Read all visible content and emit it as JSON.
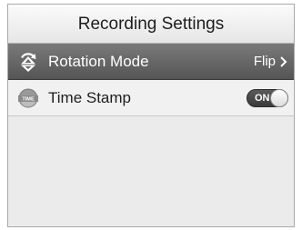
{
  "header": {
    "title": "Recording Settings"
  },
  "settings": [
    {
      "label": "Rotation Mode",
      "value": "Flip",
      "icon": "rotation-icon",
      "selected": true
    },
    {
      "label": "Time Stamp",
      "icon_text": "TIME",
      "icon": "time-stamp-icon",
      "toggle": "ON",
      "toggle_state": true
    }
  ],
  "colors": {
    "selected_row": "#606060",
    "toggle_on": "#444444",
    "background": "#ebebeb"
  }
}
